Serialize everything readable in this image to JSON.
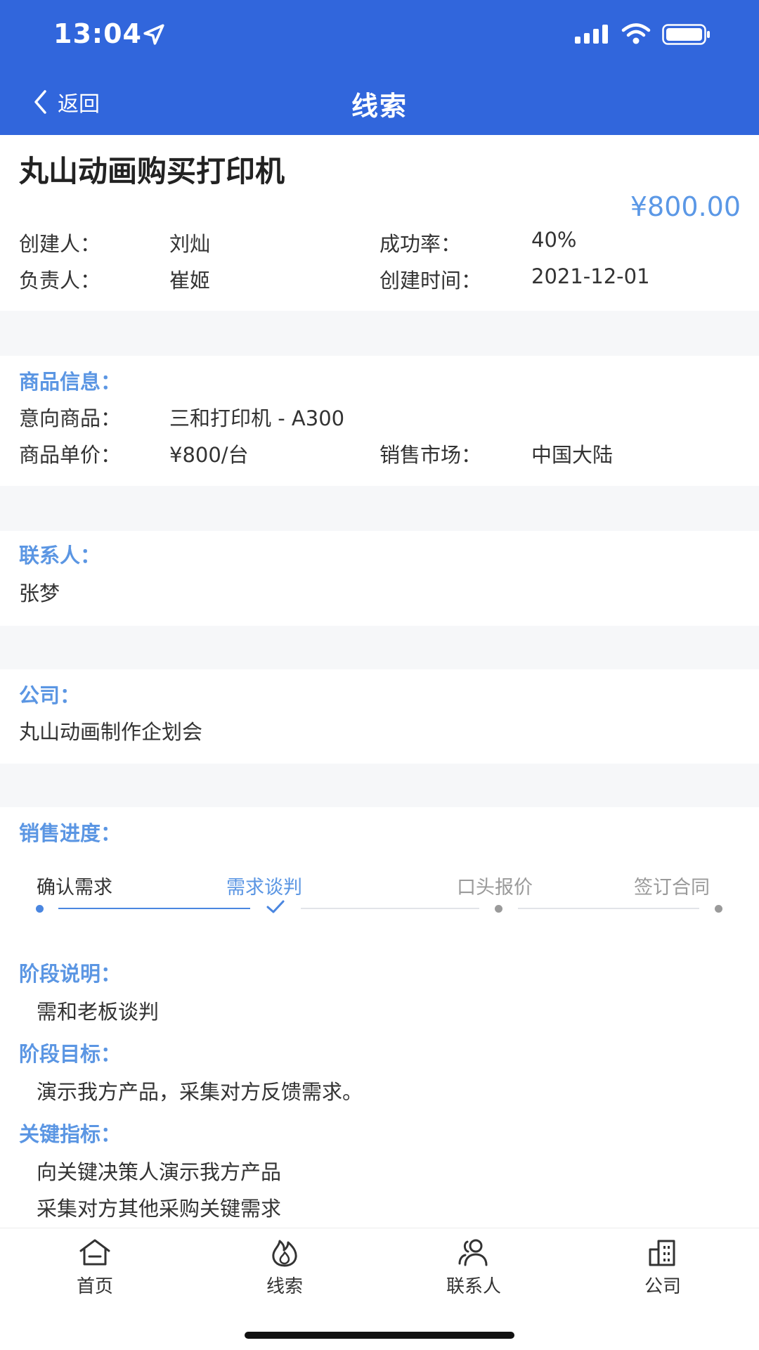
{
  "status_bar": {
    "time": "13:04"
  },
  "nav": {
    "back_label": "返回",
    "title": "线索"
  },
  "lead": {
    "title": "丸山动画购买打印机",
    "amount": "¥800.00",
    "creator_label": "创建人：",
    "creator": "刘灿",
    "success_rate_label": "成功率：",
    "success_rate": "40%",
    "owner_label": "负责人：",
    "owner": "崔姬",
    "created_time_label": "创建时间：",
    "created_time": "2021-12-01"
  },
  "product": {
    "section_label": "商品信息：",
    "intent_label": "意向商品：",
    "intent": "三和打印机 - A300",
    "unit_price_label": "商品单价：",
    "unit_price": "¥800/台",
    "market_label": "销售市场：",
    "market": "中国大陆"
  },
  "contact": {
    "section_label": "联系人：",
    "name": "张梦"
  },
  "company": {
    "section_label": "公司：",
    "name": "丸山动画制作企划会"
  },
  "progress": {
    "section_label": "销售进度：",
    "steps": [
      "确认需求",
      "需求谈判",
      "口头报价",
      "签订合同"
    ],
    "current_step": 2,
    "stage_desc_label": "阶段说明：",
    "stage_desc": "需和老板谈判",
    "stage_goal_label": "阶段目标：",
    "stage_goal": "演示我方产品，采集对方反馈需求。",
    "key_metrics_label": "关键指标：",
    "key_metrics": [
      "向关键决策人演示我方产品",
      "采集对方其他采购关键需求"
    ]
  },
  "tabbar": {
    "items": [
      {
        "label": "首页",
        "icon": "home-icon"
      },
      {
        "label": "线索",
        "icon": "flame-icon"
      },
      {
        "label": "联系人",
        "icon": "contacts-icon"
      },
      {
        "label": "公司",
        "icon": "building-icon"
      }
    ]
  },
  "colors": {
    "primary": "#3166dc",
    "accent": "#5b96e3",
    "background": "#f6f7f9"
  }
}
